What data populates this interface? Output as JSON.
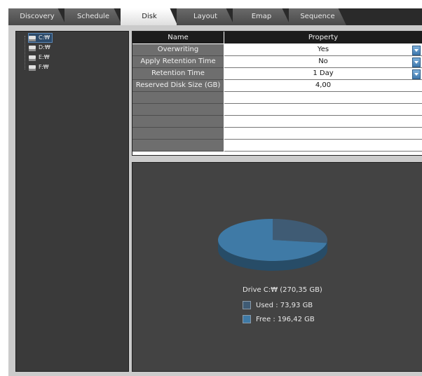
{
  "tabs": [
    {
      "label": "Discovery",
      "active": false
    },
    {
      "label": "Schedule",
      "active": false
    },
    {
      "label": "Disk",
      "active": true
    },
    {
      "label": "Layout",
      "active": false
    },
    {
      "label": "Emap",
      "active": false
    },
    {
      "label": "Sequence",
      "active": false
    }
  ],
  "drives": [
    {
      "label": "C:₩",
      "selected": true
    },
    {
      "label": "D:₩",
      "selected": false
    },
    {
      "label": "E:₩",
      "selected": false
    },
    {
      "label": "F:₩",
      "selected": false
    }
  ],
  "grid": {
    "header_name": "Name",
    "header_property": "Property",
    "rows": [
      {
        "name": "Overwriting",
        "value": "Yes",
        "dropdown": true
      },
      {
        "name": "Apply Retention Time",
        "value": "No",
        "dropdown": true
      },
      {
        "name": "Retention Time",
        "value": "1 Day",
        "dropdown": true
      },
      {
        "name": "Reserved Disk Size (GB)",
        "value": "4,00",
        "dropdown": false
      },
      {
        "name": "",
        "value": "",
        "dropdown": false
      },
      {
        "name": "",
        "value": "",
        "dropdown": false
      },
      {
        "name": "",
        "value": "",
        "dropdown": false
      },
      {
        "name": "",
        "value": "",
        "dropdown": false
      },
      {
        "name": "",
        "value": "",
        "dropdown": false
      }
    ]
  },
  "chart_data": {
    "type": "pie",
    "title": "Drive C:₩ (270,35 GB)",
    "series": [
      {
        "name": "Used",
        "label": "Used : 73,93 GB",
        "value": 73.93,
        "color": "#3f5b74"
      },
      {
        "name": "Free",
        "label": "Free : 196,42 GB",
        "value": 196.42,
        "color": "#3f7aa6"
      }
    ]
  },
  "colors": {
    "accent": "#3f7aa6",
    "panel": "#434343",
    "tabbar": "#2a2a2a"
  }
}
